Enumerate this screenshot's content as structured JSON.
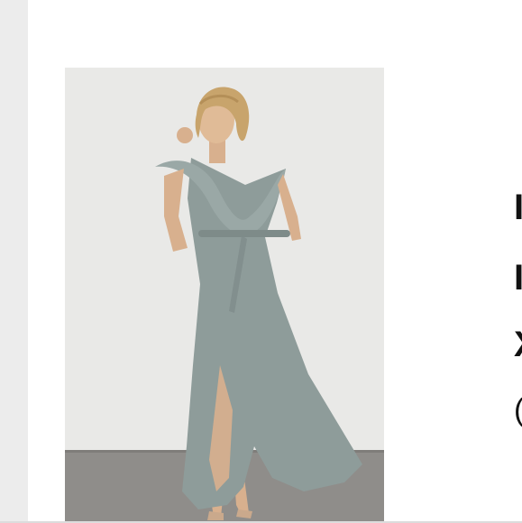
{
  "text_fragments": [
    "I",
    "I",
    "X",
    "("
  ],
  "image": {
    "icon": "dress-photo"
  },
  "colors": {
    "background": "#ffffff",
    "left_rail": "#ececec",
    "studio_wall": "#e8e8e6",
    "floor": "#8f8d8a",
    "dress": "#8e9c9a"
  }
}
